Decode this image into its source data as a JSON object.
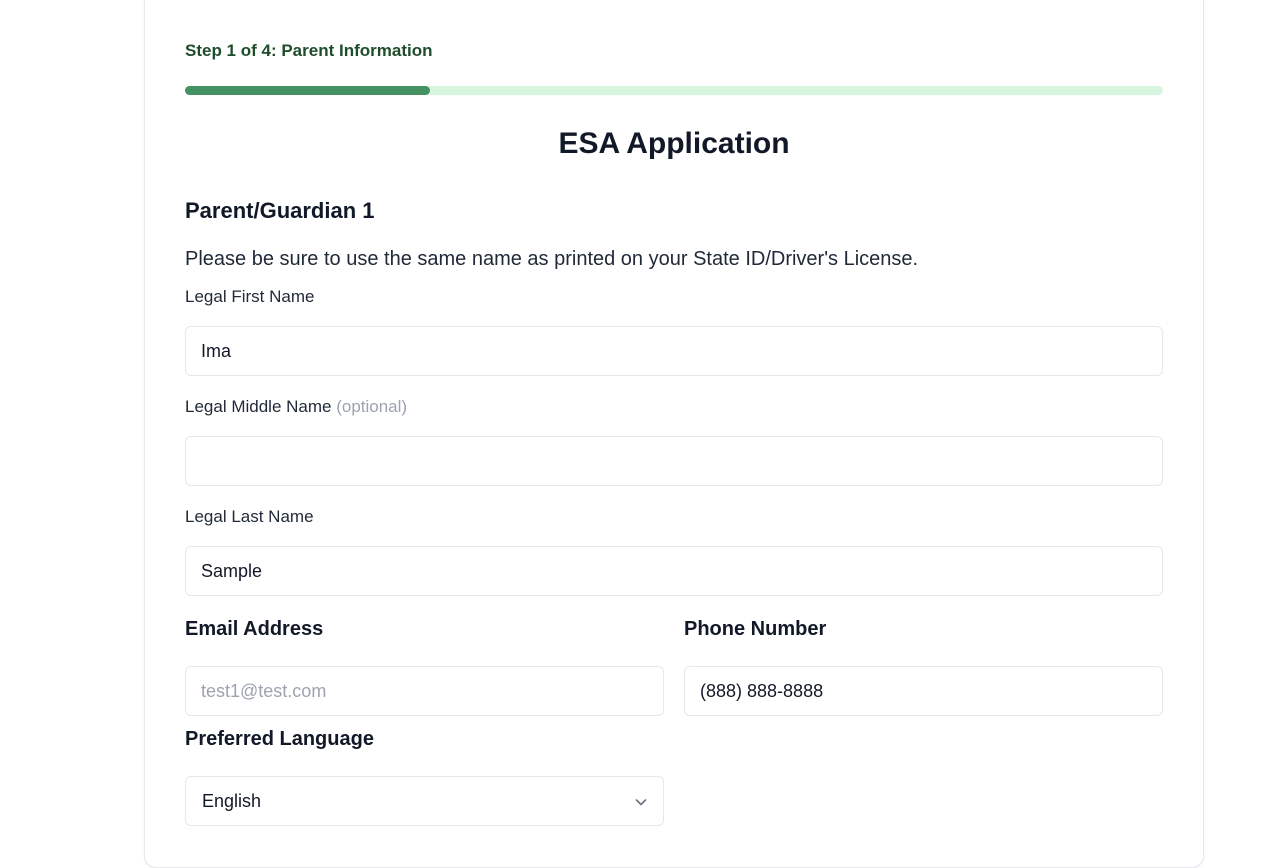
{
  "stepper": {
    "label": "Step 1 of 4: Parent Information",
    "progress_fraction": 0.25,
    "track_color": "#d8f5df",
    "fill_color": "#449162"
  },
  "form": {
    "title": "ESA Application",
    "section_heading": "Parent/Guardian 1",
    "instruction": "Please be sure to use the same name as printed on your State ID/Driver's License.",
    "first_name": {
      "label": "Legal First Name",
      "value": "Ima"
    },
    "middle_name": {
      "label": "Legal Middle Name",
      "optional_note": "(optional)",
      "value": ""
    },
    "last_name": {
      "label": "Legal Last Name",
      "value": "Sample"
    },
    "email": {
      "label": "Email Address",
      "placeholder": "test1@test.com",
      "value": ""
    },
    "phone": {
      "label": "Phone Number",
      "value": "(888) 888-8888"
    },
    "language": {
      "label": "Preferred Language",
      "selected": "English",
      "icon": "chevron-down-icon"
    }
  }
}
